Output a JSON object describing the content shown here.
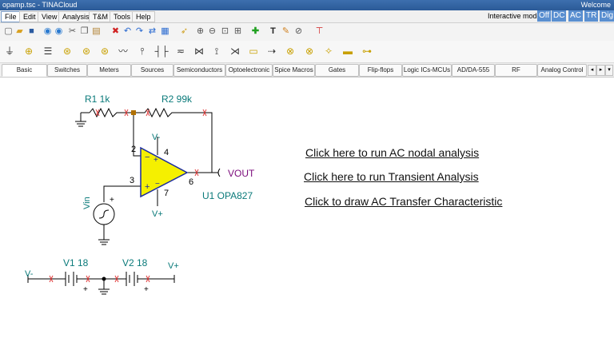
{
  "window": {
    "title": "opamp.tsc - TINACloud",
    "welcome": "Welcome"
  },
  "menu": [
    "File",
    "Edit",
    "View",
    "Analysis",
    "T&M",
    "Tools",
    "Help"
  ],
  "interactive_mode": {
    "label": "Interactive mode:",
    "modes": [
      "Off",
      "DC",
      "AC",
      "TR",
      "Dig"
    ]
  },
  "toolbar_icons": [
    "new-icon",
    "open-icon",
    "save-icon",
    "back-icon",
    "forward-icon",
    "cut-icon",
    "copy-icon",
    "paste-icon",
    "delete-icon",
    "undo-icon",
    "redo-icon",
    "wire-icon",
    "bus-icon",
    "select-icon",
    "zoom-in-icon",
    "zoom-out-icon",
    "zoom-fit-icon",
    "zoom-area-icon",
    "add-icon",
    "text-icon",
    "draw-icon",
    "probe-icon",
    "settings-icon"
  ],
  "component_icons": [
    "ground-icon",
    "battery-icon",
    "resistor-icon",
    "capacitor-icon",
    "inductor-icon",
    "source-icon",
    "ac-source-icon",
    "zigzag-icon",
    "pot-icon",
    "cap2-icon",
    "diode-icon",
    "switch-icon",
    "transformer-icon",
    "transistor-icon",
    "lamp-icon",
    "fuse-icon",
    "meter-icon",
    "led-icon",
    "relay-icon",
    "crystal-icon"
  ],
  "tabs": [
    "Basic",
    "Switches",
    "Meters",
    "Sources",
    "Semiconductors",
    "Optoelectronic",
    "Spice Macros",
    "Gates",
    "Flip-flops",
    "Logic ICs-MCUs",
    "AD/DA-555",
    "RF",
    "Analog Control"
  ],
  "schematic": {
    "r1": "R1 1k",
    "r2": "R2 99k",
    "v_minus_top": "V-",
    "pin2": "2",
    "pin3": "3",
    "pin4": "4",
    "pin6": "6",
    "pin7": "7",
    "vout": "VOUT",
    "opamp": "U1 OPA827",
    "vin": "Vin",
    "v_plus_bottom": "V+",
    "v1": "V1 18",
    "v2": "V2 18",
    "v_minus_left": "V-",
    "v_plus_right": "V+"
  },
  "links": {
    "ac_nodal": "Click here to run AC nodal analysis",
    "transient": "Click here to run Transient Analysis",
    "ac_transfer": "Click to draw AC Transfer Characteristic"
  }
}
